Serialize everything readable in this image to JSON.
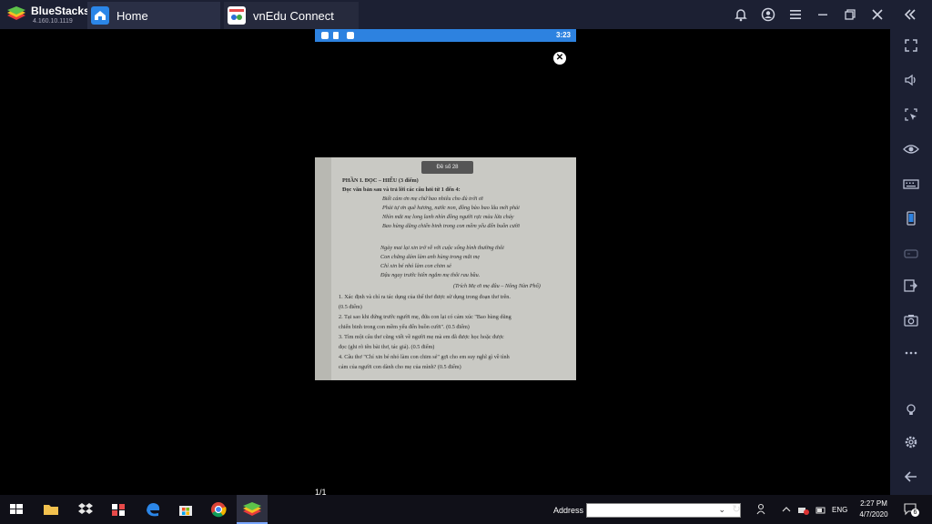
{
  "titlebar": {
    "brand_name": "BlueStacks",
    "brand_version": "4.160.10.1119",
    "tabs": [
      {
        "label": "Home",
        "icon": "home-icon"
      },
      {
        "label": "vnEdu Connect",
        "icon": "vnedu-app-icon"
      }
    ],
    "buttons": [
      "bell-icon",
      "account-icon",
      "menu-icon",
      "minimize-icon",
      "restore-icon",
      "close-icon",
      "collapse-icon"
    ]
  },
  "statusbar": {
    "time": "3:23"
  },
  "viewer": {
    "page_counter": "1/1",
    "close_icon": "close-circle-icon"
  },
  "document": {
    "badge": "Đề số 28",
    "heading1": "PHẦN I. ĐỌC – HIỂU (3 điểm)",
    "heading2": "Đọc văn bản sau và trả lời các câu hỏi từ 1 đến 4:",
    "poem1": [
      "Biết cảm ơn mẹ chứ bao nhiêu cho đủ trời ơi",
      "Phải tự ơn quê hương, nước non, đồng bào bao lâu mới phải",
      "Nhìn mắt mẹ long lanh nhìn đồng người rực màu lửa cháy",
      "Bao hùng dũng chiến binh trong con mềm yếu đến buồn cười"
    ],
    "poem2": [
      "Ngày mai lại xin trở về với cuộc sống bình thường thôi",
      "Con chẳng dám làm anh hùng trong mắt mẹ",
      "Chỉ xin bé nhỏ làm con chim sẻ",
      "Đậu ngay trước hiên ngắm mẹ thôi rau bầu."
    ],
    "source": "(Trích Mẹ ơi mẹ đâu – Nông Nàn Phố)",
    "questions": [
      "1. Xác định và chỉ ra tác dụng của thể thơ được sử dụng trong đoạn thơ trên.",
      "(0.5 điểm)",
      "2. Tại sao khi đứng trước người mẹ, đứa con lại có cảm xúc \"Bao hùng dũng",
      "chiến binh trong con mềm yếu đến buồn cười\". (0.5 điểm)",
      "3. Tìm một câu thơ cũng viết về người mẹ mà em đã được học hoặc được",
      "đọc (ghi rõ tên bài thơ, tác giả). (0.5 điểm)",
      "4. Câu thơ \"Chỉ xin bé nhỏ làm con chim sẻ\" gợi cho em suy nghĩ gì về tình",
      "cảm của người con dành cho mẹ của mình? (0.5 điểm)"
    ]
  },
  "sidebar": [
    "fullscreen-icon",
    "volume-icon",
    "pointer-icon",
    "eye-icon",
    "keyboard-icon",
    "phone-icon",
    "gamepad-icon",
    "multi-instance-icon",
    "camera-icon",
    "more-icon",
    "bulb-icon",
    "settings-icon",
    "back-icon"
  ],
  "taskbar": {
    "address_label": "Address",
    "address_value": "",
    "language": "ENG",
    "time": "2:27 PM",
    "date": "4/7/2020",
    "notification_count": "6"
  }
}
